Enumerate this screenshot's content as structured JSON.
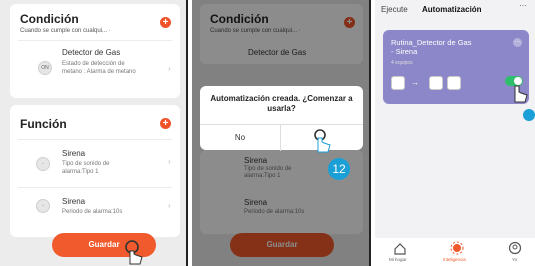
{
  "panel1": {
    "condition_title": "Condición",
    "condition_sub": "Cuando se cumple con cualqui... ·",
    "condition_device": {
      "name": "Detector de Gas",
      "desc1": "Estado de detección de",
      "desc2": "metano : Alarma de metano",
      "icon": "gas-icon"
    },
    "function_title": "Función",
    "functions": [
      {
        "name": "Sirena",
        "desc1": "Tipo de sonido de",
        "desc2": "alarma:Tipo 1",
        "icon": "siren-icon"
      },
      {
        "name": "Sirena",
        "desc1": "Periodo de alarma:10s",
        "desc2": "",
        "icon": "siren-icon"
      }
    ],
    "save_label": "Guardar",
    "accent": "#f05a2c"
  },
  "panel2": {
    "condition_title": "Condición",
    "condition_sub": "Cuando se cumple con cualqui... ·",
    "dialog_message": "Automatización creada. ¿Comenzar a usarla?",
    "no_label": "No",
    "step_number": "12"
  },
  "panel3": {
    "tabs": [
      "Ejecute",
      "Automatización"
    ],
    "more_label": "···",
    "routine": {
      "name_line1": "Rutina_Detector de Gas",
      "name_line2": "- Sirena",
      "sub": "4 equipos",
      "color": "#8c87c8",
      "enabled": true
    },
    "nav": [
      "Mi hogar",
      "Inteligencia",
      "Yo"
    ]
  }
}
